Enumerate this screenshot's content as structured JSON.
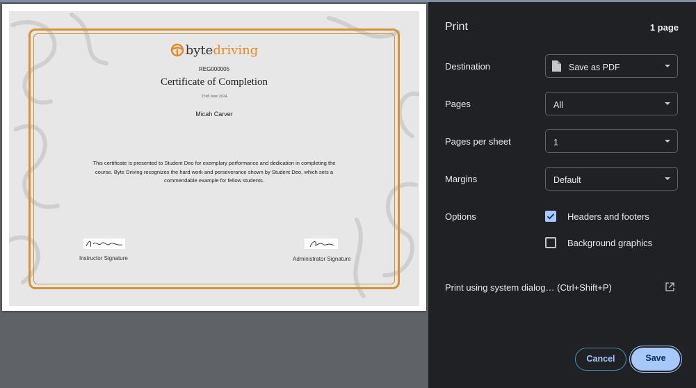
{
  "certificate": {
    "logo": {
      "part1": "byte",
      "part2": "driving"
    },
    "reg": "REG000005",
    "title": "Certificate of Completion",
    "date": "23rd June 2024",
    "recipient": "Micah Carver",
    "body": "This certificate is presented to Student Deo for exemplary performance and dedication in completing the course. Byte Driving recognizes the hard work and perseverance shown by Student Deo, which sets a commendable example for fellow students.",
    "instructor_label": "Instructor Signature",
    "admin_label": "Administrator Signature"
  },
  "panel": {
    "title": "Print",
    "page_count": "1 page",
    "destination": {
      "label": "Destination",
      "value": "Save as PDF",
      "icon": "document-icon"
    },
    "pages": {
      "label": "Pages",
      "value": "All"
    },
    "pages_per_sheet": {
      "label": "Pages per sheet",
      "value": "1"
    },
    "margins": {
      "label": "Margins",
      "value": "Default"
    },
    "options": {
      "label": "Options",
      "headers_footers": {
        "label": "Headers and footers",
        "checked": true
      },
      "background_graphics": {
        "label": "Background graphics",
        "checked": false
      }
    },
    "system_dialog": "Print using system dialog… (Ctrl+Shift+P)",
    "cancel": "Cancel",
    "save": "Save"
  },
  "colors": {
    "accent": "#a8c7fa",
    "frame": "#d3913e",
    "panel_bg": "#202124"
  }
}
